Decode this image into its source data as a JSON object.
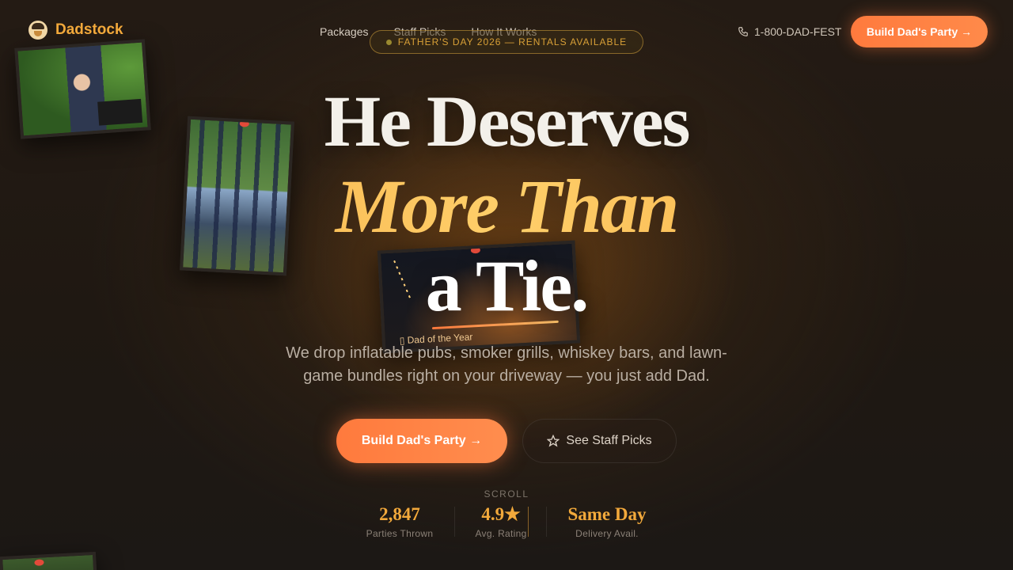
{
  "brand": {
    "name": "Dadstock"
  },
  "nav": {
    "items": [
      "Packages",
      "Staff Picks",
      "How It Works"
    ]
  },
  "header": {
    "phone": "1-800-DAD-FEST",
    "cta_label": "Build Dad's Party →"
  },
  "badge": {
    "text": "FATHER'S DAY 2026 — RENTALS AVAILABLE"
  },
  "hero": {
    "line1": "He Deserves",
    "line2": "More Than",
    "line3": "a Tie.",
    "subtext": "We drop inflatable pubs, smoker grills, whiskey bars, and lawn-game bundles right on your driveway — you just add Dad.",
    "primary_cta": "Build Dad's Party →",
    "secondary_cta": "See Staff Picks",
    "scroll_hint": "SCROLL"
  },
  "photos": {
    "photo3_caption": "Dad of the Year"
  },
  "stats": [
    {
      "value": "2,847",
      "label": "Parties Thrown"
    },
    {
      "value": "4.9★",
      "label": "Avg. Rating"
    },
    {
      "value": "Same Day",
      "label": "Delivery Avail."
    }
  ],
  "colors": {
    "accent": "#f2a93b",
    "cta": "#ff7a3d",
    "background": "#201913"
  },
  "icons": {
    "logo": "dad-face-icon",
    "phone": "phone-icon",
    "star": "star-icon"
  }
}
